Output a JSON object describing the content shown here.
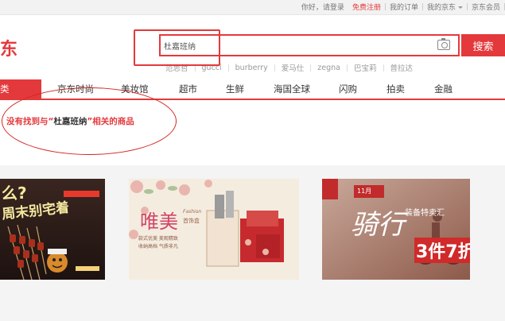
{
  "topbar": {
    "greeting": "你好，请登录",
    "register": "免费注册",
    "my_orders": "我的订单",
    "my_jd": "我的京东",
    "jd_member": "京东会员"
  },
  "logo": {
    "fragment": "东"
  },
  "search": {
    "value": "杜嘉班纳",
    "button_label": "搜索"
  },
  "hot_words": [
    "范思哲",
    "gucci",
    "burberry",
    "爱马仕",
    "zegna",
    "巴宝莉",
    "普拉达"
  ],
  "nav": {
    "first_label": "类",
    "items": [
      "京东时尚",
      "美妆馆",
      "超市",
      "生鲜",
      "海国全球",
      "闪购",
      "拍卖",
      "金融"
    ]
  },
  "no_result": {
    "prefix": "没有找到与“",
    "keyword": "杜嘉班纳",
    "suffix": "”相关的商品"
  },
  "ads": [
    {
      "name": "bbq-weekend-banner",
      "texts": [
        "么?",
        "周末别宅着"
      ]
    },
    {
      "name": "jewelry-box-banner",
      "texts": [
        "唯美",
        "Fashion",
        "首饰盒",
        "款式优美 美观精致",
        "收纳高档 气质非凡"
      ]
    },
    {
      "name": "cycling-sale-banner",
      "texts": [
        "骑行",
        "装备特卖汇",
        "3件7折",
        "11月"
      ]
    }
  ],
  "colors": {
    "brand_red": "#e4393c",
    "annotation_red": "#d2261f"
  }
}
